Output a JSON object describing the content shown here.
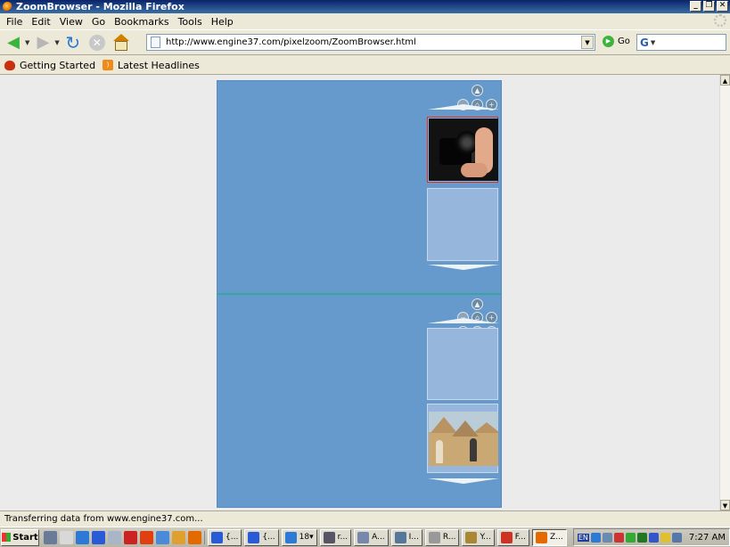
{
  "window": {
    "title": "ZoomBrowser - Mozilla Firefox",
    "buttons": {
      "minimize": "_",
      "restore": "❐",
      "close": "✕"
    }
  },
  "menubar": {
    "items": [
      {
        "label": "File"
      },
      {
        "label": "Edit"
      },
      {
        "label": "View"
      },
      {
        "label": "Go"
      },
      {
        "label": "Bookmarks"
      },
      {
        "label": "Tools"
      },
      {
        "label": "Help"
      }
    ]
  },
  "navigation": {
    "url": "http://www.engine37.com/pixelzoom/ZoomBrowser.html",
    "go_label": "Go",
    "search_value": ""
  },
  "bookmarks": [
    {
      "label": "Getting Started",
      "icon": "ladybug-icon"
    },
    {
      "label": "Latest Headlines",
      "icon": "rss-icon"
    }
  ],
  "zoom_browser": {
    "colors": {
      "background": "#6699cc",
      "divider": "#35a7a0",
      "selected_border": "#cc3030"
    },
    "controls": {
      "up": "▲",
      "down": "▼",
      "zoom_in": "+",
      "zoom_out": "−",
      "home": "⌂"
    },
    "top_panel": {
      "thumbnails": [
        {
          "type": "photo",
          "subject": "camera",
          "selected": true
        },
        {
          "type": "empty",
          "selected": false
        }
      ]
    },
    "bottom_panel": {
      "thumbnails": [
        {
          "type": "empty",
          "selected": false
        },
        {
          "type": "photo",
          "subject": "pyramids",
          "selected": false
        }
      ]
    }
  },
  "status": {
    "text": "Transferring data from www.engine37.com..."
  },
  "taskbar": {
    "start_label": "Start",
    "tasks": [
      {
        "label": "{...",
        "icon_color": "#2a5bd7"
      },
      {
        "label": "{...",
        "icon_color": "#2a5bd7"
      },
      {
        "label": "18▾",
        "icon_color": "#2d7ad6"
      },
      {
        "label": "r...",
        "icon_color": "#556"
      },
      {
        "label": "A...",
        "icon_color": "#7788aa"
      },
      {
        "label": "I...",
        "icon_color": "#557799"
      },
      {
        "label": "R...",
        "icon_color": "#999"
      },
      {
        "label": "Y...",
        "icon_color": "#aa8833"
      },
      {
        "label": "F...",
        "icon_color": "#cc3322"
      },
      {
        "label": "Z...",
        "icon_color": "#e46a00",
        "active": true
      }
    ],
    "tray": {
      "lang": "EN",
      "clock": "7:27 AM"
    }
  }
}
